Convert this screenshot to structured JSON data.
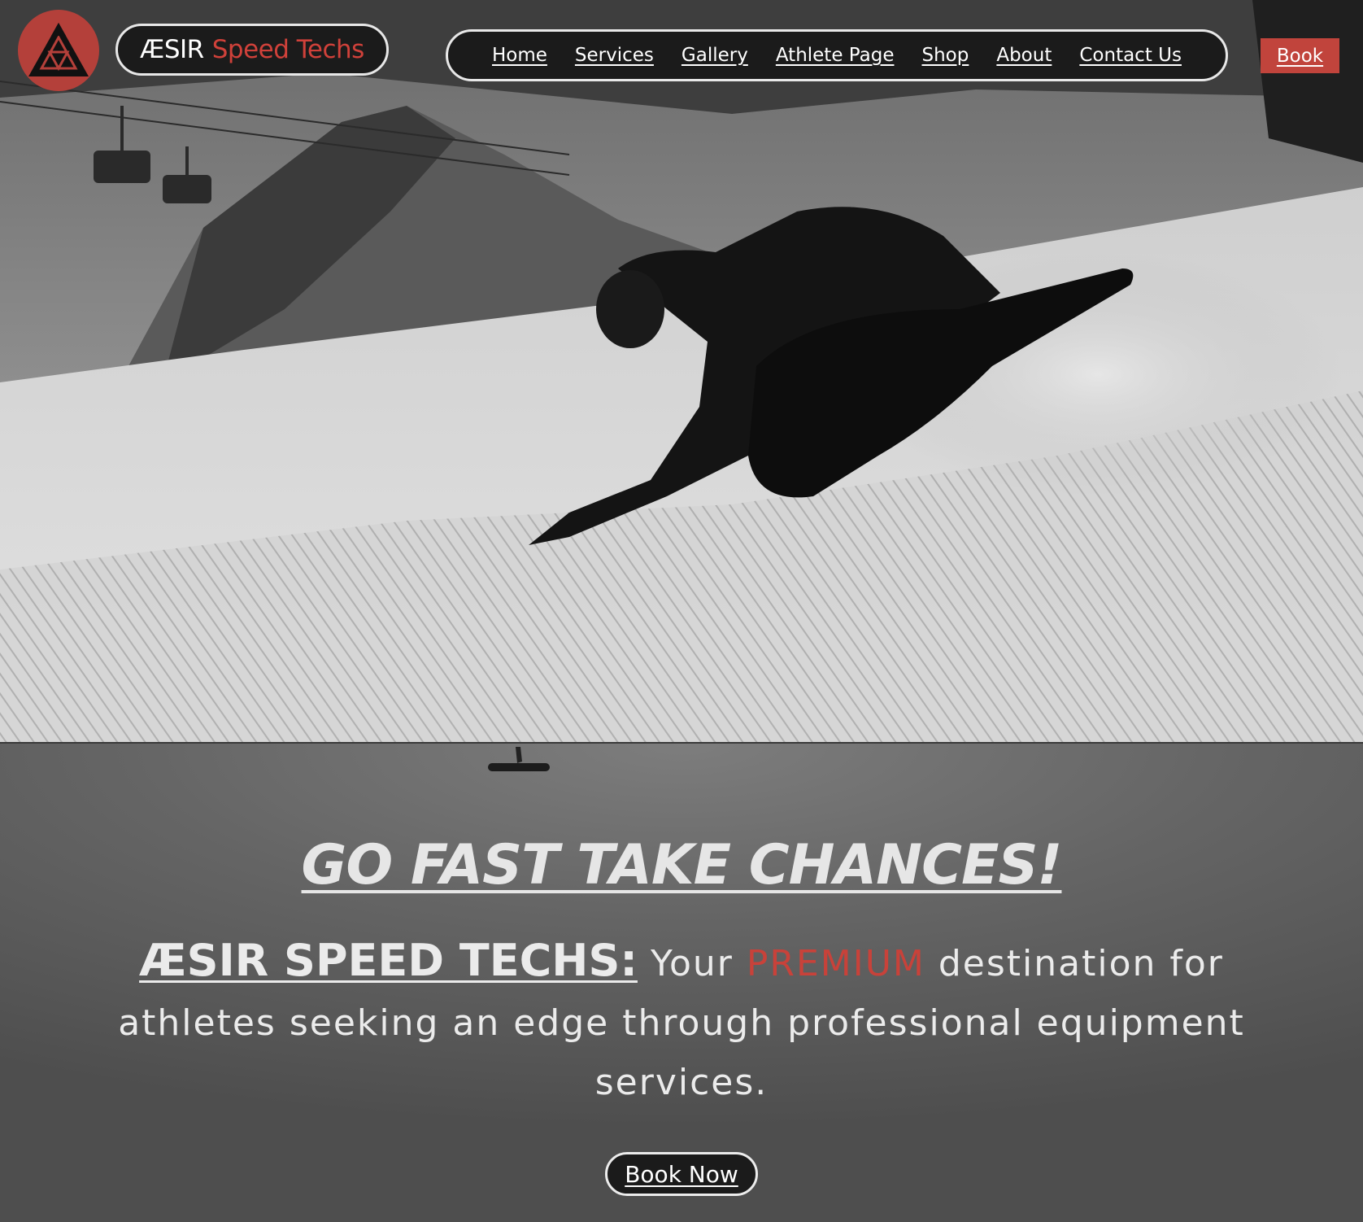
{
  "brand": {
    "name_part1": "ÆSIR",
    "name_part2": "Speed Techs",
    "logo_icon": "valknut-triangle-icon"
  },
  "nav": {
    "items": [
      {
        "label": "Home"
      },
      {
        "label": "Services"
      },
      {
        "label": "Gallery"
      },
      {
        "label": "Athlete Page"
      },
      {
        "label": "Shop"
      },
      {
        "label": "About"
      },
      {
        "label": "Contact Us"
      }
    ],
    "book_label": "Book"
  },
  "hero": {
    "image_subject": "snowboarder carving on groomed slope"
  },
  "content": {
    "headline": "GO FAST TAKE CHANCES!",
    "tagline_brand": "ÆSIR SPEED TECHS:",
    "tagline_pre": " Your ",
    "tagline_highlight": "PREMIUM",
    "tagline_post": " destination for athletes seeking an edge through professional equipment services.",
    "cta_label": "Book Now"
  },
  "colors": {
    "accent_red": "#c1443c",
    "pill_bg": "#1b1b1b",
    "pill_border": "#e8e8e8"
  }
}
